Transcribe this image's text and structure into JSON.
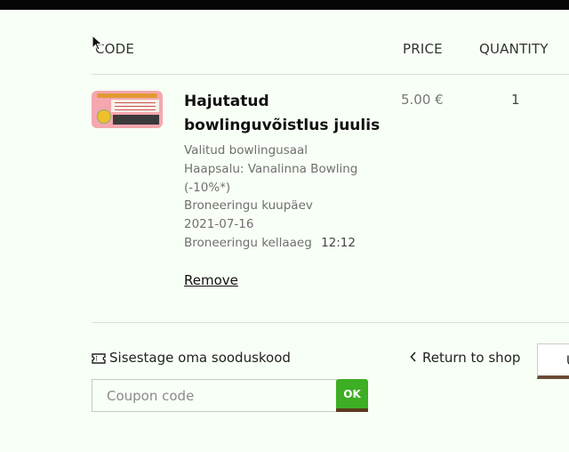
{
  "table_header": {
    "product": "CODE",
    "price": "PRICE",
    "quantity": "QUANTITY"
  },
  "item": {
    "name": "Hajutatud bowlinguvõistlus juulis",
    "price": "5.00 €",
    "quantity": "1",
    "details": {
      "hall_label": "Valitud bowlingusaal",
      "hall_value": "Haapsalu: Vanalinna Bowling",
      "discount": "(-10%*)",
      "date_label": "Broneeringu kuupäev",
      "date_value": "2021-07-16",
      "time_label": "Broneeringu kellaaeg",
      "time_value": "12:12"
    },
    "remove_label": "Remove"
  },
  "coupon": {
    "label": "Sisestage oma sooduskood",
    "placeholder": "Coupon code",
    "apply_label": "OK",
    "icon": "ticket-icon"
  },
  "actions": {
    "return_label": "Return to shop",
    "update_label": "U"
  },
  "colors": {
    "background": "#f8fff6",
    "ok_button": "#3eae24",
    "button_border": "#5b3a1e",
    "topbar": "#050505"
  }
}
